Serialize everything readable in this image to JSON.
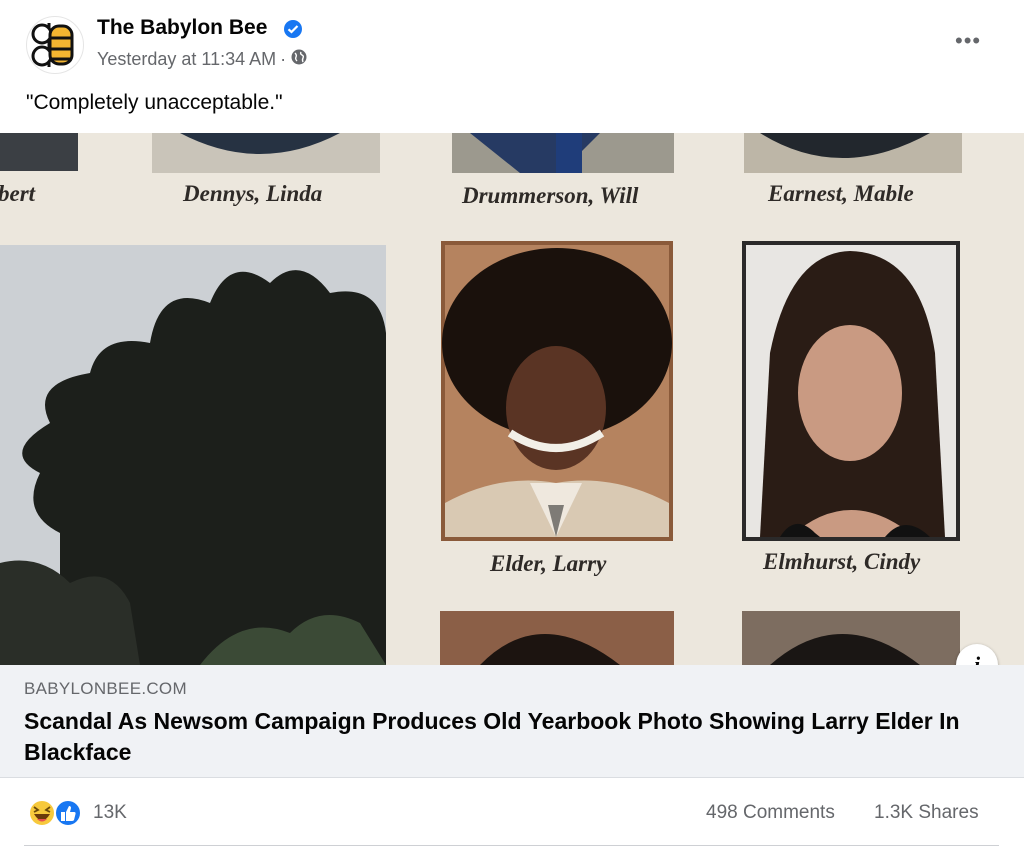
{
  "post": {
    "page_name": "The Babylon Bee",
    "timestamp": "Yesterday at 11:34 AM",
    "separator": "·",
    "caption": "\"Completely unacceptable.\"",
    "audience_icon": "globe-icon",
    "verified_icon": "verified-badge-icon"
  },
  "photo": {
    "top_names": [
      "bert",
      "Dennys, Linda",
      "Drummerson, Will",
      "Earnest, Mable"
    ],
    "middle_names": [
      "Elder, Larry",
      "Elmhurst, Cindy"
    ]
  },
  "link_preview": {
    "domain": "BABYLONBEE.COM",
    "headline": "Scandal As Newsom Campaign Produces Old Yearbook Photo Showing Larry Elder In Blackface"
  },
  "footer": {
    "reaction_count": "13K",
    "comments": "498 Comments",
    "shares": "1.3K Shares",
    "reaction_icons": [
      "haha-icon",
      "like-icon"
    ]
  },
  "colors": {
    "accent": "#1877f2",
    "secondary_text": "#65676b",
    "preview_bg": "#f0f2f5",
    "logo_yellow": "#f3b531"
  }
}
